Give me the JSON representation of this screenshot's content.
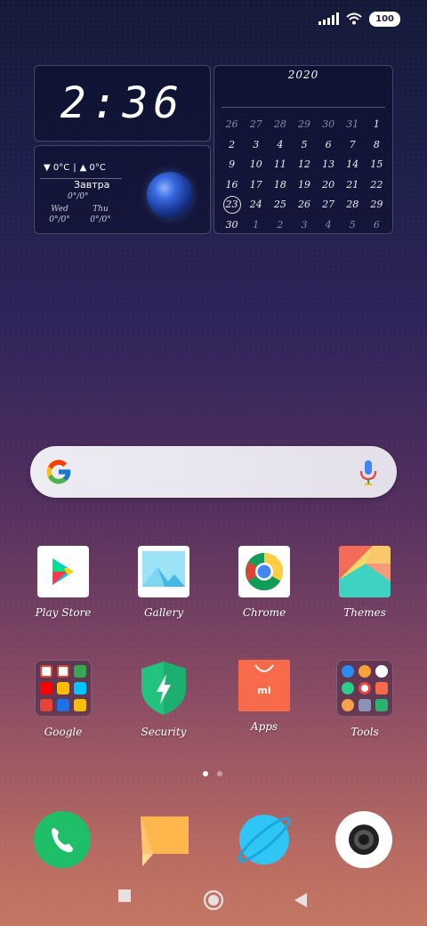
{
  "status_bar": {
    "battery": "100",
    "signal_icon": "signal-icon",
    "wifi_icon": "wifi-icon"
  },
  "clock_widget": {
    "time": "2:36"
  },
  "weather_widget": {
    "low": "▼ 0°C",
    "separator": "|",
    "high": "▲ 0°C",
    "tomorrow_label": "Завтра",
    "tomorrow_temp": "0°/0°",
    "forecast": [
      {
        "day": "Wed",
        "temp": "0°/0°"
      },
      {
        "day": "Thu",
        "temp": "0°/0°"
      }
    ]
  },
  "calendar_widget": {
    "year": "2020",
    "days": [
      {
        "d": "26",
        "dim": true
      },
      {
        "d": "27",
        "dim": true
      },
      {
        "d": "28",
        "dim": true
      },
      {
        "d": "29",
        "dim": true
      },
      {
        "d": "30",
        "dim": true
      },
      {
        "d": "31",
        "dim": true
      },
      {
        "d": "1"
      },
      {
        "d": "2"
      },
      {
        "d": "3"
      },
      {
        "d": "4"
      },
      {
        "d": "5"
      },
      {
        "d": "6"
      },
      {
        "d": "7"
      },
      {
        "d": "8"
      },
      {
        "d": "9"
      },
      {
        "d": "10"
      },
      {
        "d": "11"
      },
      {
        "d": "12"
      },
      {
        "d": "13"
      },
      {
        "d": "14"
      },
      {
        "d": "15"
      },
      {
        "d": "16"
      },
      {
        "d": "17"
      },
      {
        "d": "18"
      },
      {
        "d": "19"
      },
      {
        "d": "20"
      },
      {
        "d": "21"
      },
      {
        "d": "22"
      },
      {
        "d": "23",
        "today": true
      },
      {
        "d": "24"
      },
      {
        "d": "25"
      },
      {
        "d": "26"
      },
      {
        "d": "27"
      },
      {
        "d": "28"
      },
      {
        "d": "29"
      },
      {
        "d": "30"
      },
      {
        "d": "1",
        "dim": true
      },
      {
        "d": "2",
        "dim": true
      },
      {
        "d": "3",
        "dim": true
      },
      {
        "d": "4",
        "dim": true
      },
      {
        "d": "5",
        "dim": true
      },
      {
        "d": "6",
        "dim": true
      }
    ]
  },
  "search": {
    "google_icon": "google-g-icon",
    "mic_icon": "mic-icon"
  },
  "apps_row1": [
    {
      "label": "Play Store",
      "icon": "play-store-icon"
    },
    {
      "label": "Gallery",
      "icon": "gallery-icon"
    },
    {
      "label": "Chrome",
      "icon": "chrome-icon"
    },
    {
      "label": "Themes",
      "icon": "themes-icon"
    }
  ],
  "apps_row2": [
    {
      "label": "Google",
      "icon": "google-folder-icon"
    },
    {
      "label": "Security",
      "icon": "security-icon"
    },
    {
      "label": "Apps",
      "icon": "apps-store-icon"
    },
    {
      "label": "Tools",
      "icon": "tools-folder-icon"
    }
  ],
  "page_indicator": {
    "pages": 2,
    "active": 1
  },
  "dock": [
    "phone-icon",
    "messages-icon",
    "browser-icon",
    "camera-icon"
  ],
  "nav": [
    "recents-button",
    "home-button",
    "back-button"
  ],
  "colors": {
    "phone": "#1fbf6a",
    "messages": "#ffc46b",
    "browser": "#2fc6f5",
    "security": "#22c37e",
    "apps": "#f76b4a"
  }
}
